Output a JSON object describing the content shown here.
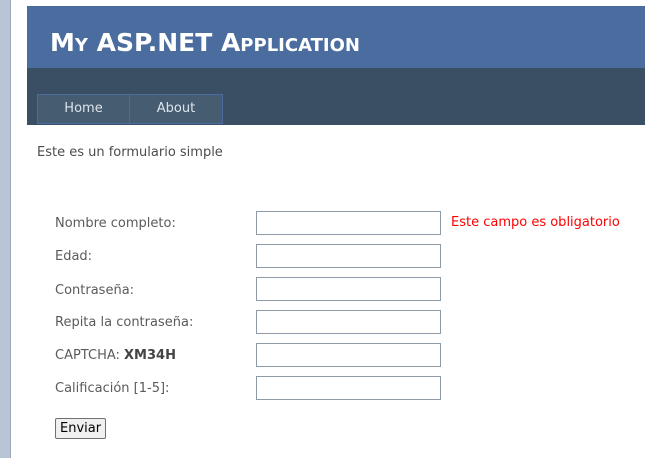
{
  "header": {
    "title": "My ASP.NET Application",
    "menu": [
      {
        "label": "Home"
      },
      {
        "label": "About"
      }
    ]
  },
  "form": {
    "intro": "Este es un formulario simple",
    "fields": {
      "nombre": {
        "label": "Nombre completo:",
        "value": "",
        "error": "Este campo es obligatorio"
      },
      "edad": {
        "label": "Edad:",
        "value": ""
      },
      "password": {
        "label": "Contraseña:",
        "value": ""
      },
      "password_repeat": {
        "label": "Repita la contraseña:",
        "value": ""
      },
      "captcha": {
        "label": "CAPTCHA:",
        "code": "XM34H",
        "value": ""
      },
      "calificacion": {
        "label": "Calificación [1-5]:",
        "value": ""
      }
    },
    "submit_label": "Enviar"
  },
  "colors": {
    "header_bg": "#4b6c9e",
    "menu_bar_bg": "#3a4f63",
    "error": "#ff0000"
  }
}
